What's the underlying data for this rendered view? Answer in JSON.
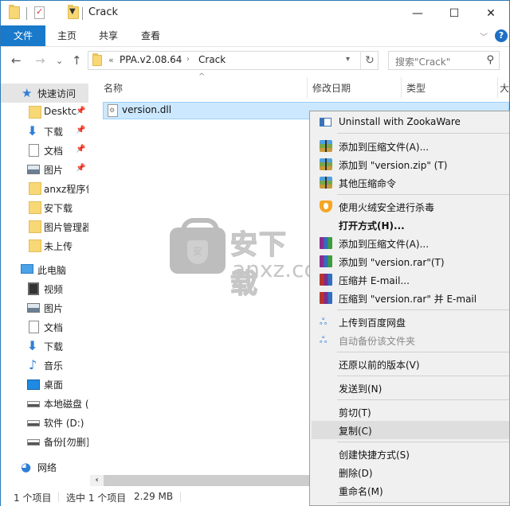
{
  "window": {
    "title": "Crack",
    "controls": {
      "minimize": "—",
      "maximize": "☐",
      "close": "✕"
    }
  },
  "ribbon": {
    "tabs": [
      {
        "label": "文件",
        "active": true
      },
      {
        "label": "主页"
      },
      {
        "label": "共享"
      },
      {
        "label": "查看"
      }
    ],
    "help": "?"
  },
  "nav": {
    "back": "←",
    "forward": "→",
    "recent": "⌄",
    "up": "↑"
  },
  "address": {
    "overflow": "«",
    "segments": [
      "PPA.v2.08.64",
      "Crack"
    ],
    "separator": "›",
    "refresh": "↻"
  },
  "search": {
    "placeholder": "搜索\"Crack\"",
    "icon": "search-icon"
  },
  "navpane": {
    "quick_access": {
      "label": "快速访问",
      "items": [
        {
          "label": "Desktc",
          "icon": "folder-icon",
          "pinned": true
        },
        {
          "label": "下载",
          "icon": "download-icon",
          "pinned": true
        },
        {
          "label": "文档",
          "icon": "document-icon",
          "pinned": true
        },
        {
          "label": "图片",
          "icon": "pictures-icon",
          "pinned": true
        },
        {
          "label": "anxz程序包",
          "icon": "folder-icon"
        },
        {
          "label": "安下载",
          "icon": "folder-icon"
        },
        {
          "label": "图片管理器",
          "icon": "folder-icon"
        },
        {
          "label": "未上传",
          "icon": "folder-icon"
        }
      ]
    },
    "this_pc": {
      "label": "此电脑",
      "items": [
        {
          "label": "视频",
          "icon": "video-icon"
        },
        {
          "label": "图片",
          "icon": "pictures-icon"
        },
        {
          "label": "文档",
          "icon": "document-icon"
        },
        {
          "label": "下载",
          "icon": "download-icon"
        },
        {
          "label": "音乐",
          "icon": "music-icon"
        },
        {
          "label": "桌面",
          "icon": "desktop-icon"
        },
        {
          "label": "本地磁盘 (C:)",
          "icon": "drive-icon"
        },
        {
          "label": "软件 (D:)",
          "icon": "drive-icon"
        },
        {
          "label": "备份[勿删]",
          "icon": "drive-icon"
        }
      ]
    },
    "network": {
      "label": "网络"
    }
  },
  "columns": [
    {
      "label": "名称",
      "sorted": "ascending"
    },
    {
      "label": "修改日期"
    },
    {
      "label": "类型"
    },
    {
      "label": "大"
    }
  ],
  "files": [
    {
      "name": "version.dll",
      "selected": true
    }
  ],
  "watermark": {
    "cn": "安下载",
    "en": "anxz.com"
  },
  "status": {
    "count": "1 个项目",
    "selection": "选中 1 个项目",
    "size": "2.29 MB"
  },
  "context_menu": {
    "items": [
      {
        "label": "Uninstall with ZookaWare",
        "icon": "zookaware-icon"
      },
      {
        "separator": true
      },
      {
        "label": "添加到压缩文件(A)...",
        "icon": "zip-archive-icon"
      },
      {
        "label": "添加到 \"version.zip\" (T)",
        "icon": "zip-archive-icon"
      },
      {
        "label": "其他压缩命令",
        "icon": "zip-archive-icon"
      },
      {
        "separator": true
      },
      {
        "label": "使用火绒安全进行杀毒",
        "icon": "huorong-shield-icon"
      },
      {
        "label": "打开方式(H)...",
        "bold": true
      },
      {
        "label": "添加到压缩文件(A)...",
        "icon": "winrar-icon"
      },
      {
        "label": "添加到 \"version.rar\"(T)",
        "icon": "winrar-icon"
      },
      {
        "label": "压缩并 E-mail...",
        "icon": "winrar-email-icon"
      },
      {
        "label": "压缩到 \"version.rar\" 并 E-mail",
        "icon": "winrar-email-icon"
      },
      {
        "separator": true
      },
      {
        "label": "上传到百度网盘",
        "icon": "baidu-netdisk-icon"
      },
      {
        "label": "自动备份该文件夹",
        "icon": "baidu-netdisk-icon",
        "disabled": true
      },
      {
        "separator": true
      },
      {
        "label": "还原以前的版本(V)"
      },
      {
        "separator": true
      },
      {
        "label": "发送到(N)"
      },
      {
        "separator": true
      },
      {
        "label": "剪切(T)"
      },
      {
        "label": "复制(C)",
        "highlighted": true
      },
      {
        "separator": true
      },
      {
        "label": "创建快捷方式(S)"
      },
      {
        "label": "删除(D)"
      },
      {
        "label": "重命名(M)"
      },
      {
        "separator": true
      }
    ]
  }
}
